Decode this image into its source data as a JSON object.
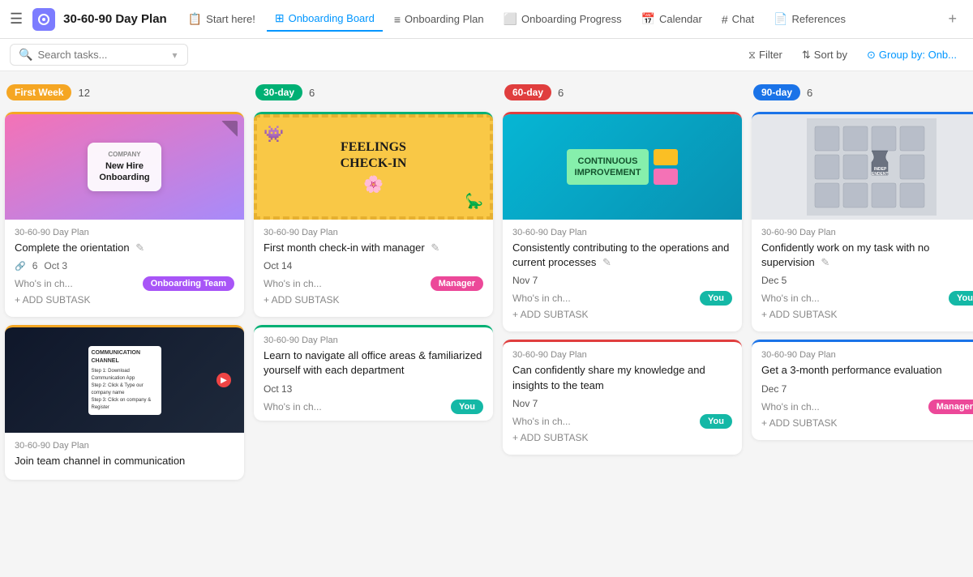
{
  "app": {
    "icon": "☁",
    "title": "30-60-90 Day Plan"
  },
  "nav": {
    "hamburger": "☰",
    "tabs": [
      {
        "id": "start",
        "icon": "📄",
        "label": "Start here!",
        "active": false
      },
      {
        "id": "board",
        "icon": "⊞",
        "label": "Onboarding Board",
        "active": true
      },
      {
        "id": "plan",
        "icon": "≡",
        "label": "Onboarding Plan",
        "active": false
      },
      {
        "id": "progress",
        "icon": "⬜",
        "label": "Onboarding Progress",
        "active": false
      },
      {
        "id": "calendar",
        "icon": "📅",
        "label": "Calendar",
        "active": false
      },
      {
        "id": "chat",
        "icon": "#",
        "label": "Chat",
        "active": false
      },
      {
        "id": "references",
        "icon": "📄",
        "label": "References",
        "active": false
      }
    ],
    "plus": "+"
  },
  "toolbar": {
    "search_placeholder": "Search tasks...",
    "filter_label": "Filter",
    "sort_label": "Sort by",
    "group_label": "Group by: Onb..."
  },
  "columns": [
    {
      "id": "first-week",
      "badge_label": "First Week",
      "badge_class": "badge-yellow",
      "bar_class": "bar-yellow",
      "col_class": "col-yellow",
      "count": "12",
      "cards": [
        {
          "id": "c1",
          "image_type": "onboarding",
          "project": "30-60-90 Day Plan",
          "title": "Complete the orientation",
          "has_subtask_count": true,
          "subtask_count": "6",
          "date": "Oct 3",
          "whos_label": "Who's in ch...",
          "tag_label": "Onboarding Team",
          "tag_class": "tag-purple",
          "add_subtask": "+ ADD SUBTASK"
        },
        {
          "id": "c2",
          "image_type": "channel",
          "project": "30-60-90 Day Plan",
          "title": "Join team channel in communication",
          "whos_label": "",
          "add_subtask": ""
        }
      ]
    },
    {
      "id": "30-day",
      "badge_label": "30-day",
      "badge_class": "badge-green",
      "bar_class": "bar-green",
      "col_class": "col-green",
      "count": "6",
      "cards": [
        {
          "id": "c3",
          "image_type": "feelings",
          "project": "30-60-90 Day Plan",
          "title": "First month check-in with manager",
          "date": "Oct 14",
          "whos_label": "Who's in ch...",
          "tag_label": "Manager",
          "tag_class": "tag-pink",
          "add_subtask": "+ ADD SUBTASK"
        },
        {
          "id": "c4",
          "image_type": "none",
          "project": "30-60-90 Day Plan",
          "title": "Learn to navigate all office areas & familiarized yourself with each department",
          "date": "Oct 13",
          "whos_label": "Who's in ch...",
          "tag_label": "You",
          "tag_class": "tag-teal",
          "add_subtask": ""
        }
      ]
    },
    {
      "id": "60-day",
      "badge_label": "60-day",
      "badge_class": "badge-red",
      "bar_class": "bar-red",
      "col_class": "col-red",
      "count": "6",
      "cards": [
        {
          "id": "c5",
          "image_type": "continuous",
          "project": "30-60-90 Day Plan",
          "title": "Consistently contributing to the operations and current processes",
          "date": "Nov 7",
          "whos_label": "Who's in ch...",
          "tag_label": "You",
          "tag_class": "tag-teal",
          "add_subtask": "+ ADD SUBTASK"
        },
        {
          "id": "c6",
          "image_type": "none",
          "project": "30-60-90 Day Plan",
          "title": "Can confidently share my knowledge and insights to the team",
          "date": "Nov 7",
          "whos_label": "Who's in ch...",
          "tag_label": "You",
          "tag_class": "tag-teal",
          "add_subtask": "+ ADD SUBTASK"
        }
      ]
    },
    {
      "id": "90-day",
      "badge_label": "90-day",
      "badge_class": "badge-blue",
      "bar_class": "bar-blue",
      "col_class": "col-blue",
      "count": "6",
      "cards": [
        {
          "id": "c7",
          "image_type": "puzzle",
          "project": "30-60-90 Day Plan",
          "title": "Confidently work on my task with no supervision",
          "date": "Dec 5",
          "whos_label": "Who's in ch...",
          "tag_label": "You",
          "tag_class": "tag-teal",
          "add_subtask": "+ ADD SUBTASK"
        },
        {
          "id": "c8",
          "image_type": "none",
          "project": "30-60-90 Day Plan",
          "title": "Get a 3-month performance evaluation",
          "date": "Dec 7",
          "whos_label": "Who's in ch...",
          "tag_label": "Manager",
          "tag_class": "tag-pink",
          "add_subtask": "+ ADD SUBTASK"
        }
      ]
    }
  ]
}
